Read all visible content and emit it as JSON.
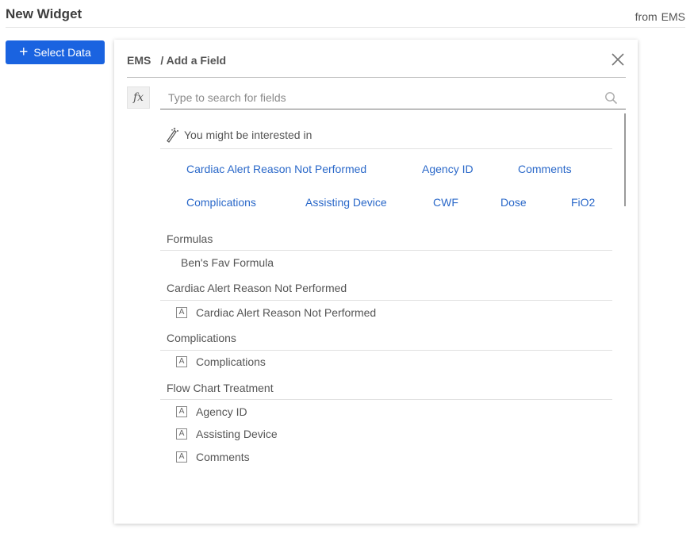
{
  "header": {
    "title": "New Widget",
    "source_prefix": "from",
    "source_name": "EMS"
  },
  "toolbar": {
    "select_data_label": "Select Data",
    "plus_glyph": "+"
  },
  "panel": {
    "breadcrumb_root": "EMS",
    "breadcrumb_current": "/ Add a Field",
    "fx_label": "fx",
    "search_placeholder": "Type to search for fields",
    "search_value": "",
    "suggestions_title": "You might be interested in",
    "suggestions": [
      "Cardiac Alert Reason Not Performed",
      "Agency ID",
      "Comments",
      "Complications",
      "Assisting Device",
      "CWF",
      "Dose",
      "FiO2"
    ],
    "type_glyph": "A",
    "sections": [
      {
        "title": "Formulas",
        "items": [
          "Ben's Fav Formula"
        ]
      },
      {
        "title": "Cardiac Alert Reason Not Performed",
        "items": [
          "Cardiac Alert Reason Not Performed"
        ]
      },
      {
        "title": "Complications",
        "items": [
          "Complications"
        ]
      },
      {
        "title": "Flow Chart Treatment",
        "items": [
          "Agency ID",
          "Assisting Device",
          "Comments"
        ]
      }
    ]
  },
  "colors": {
    "accent": "#1a63e0",
    "link": "#2a68c9"
  }
}
